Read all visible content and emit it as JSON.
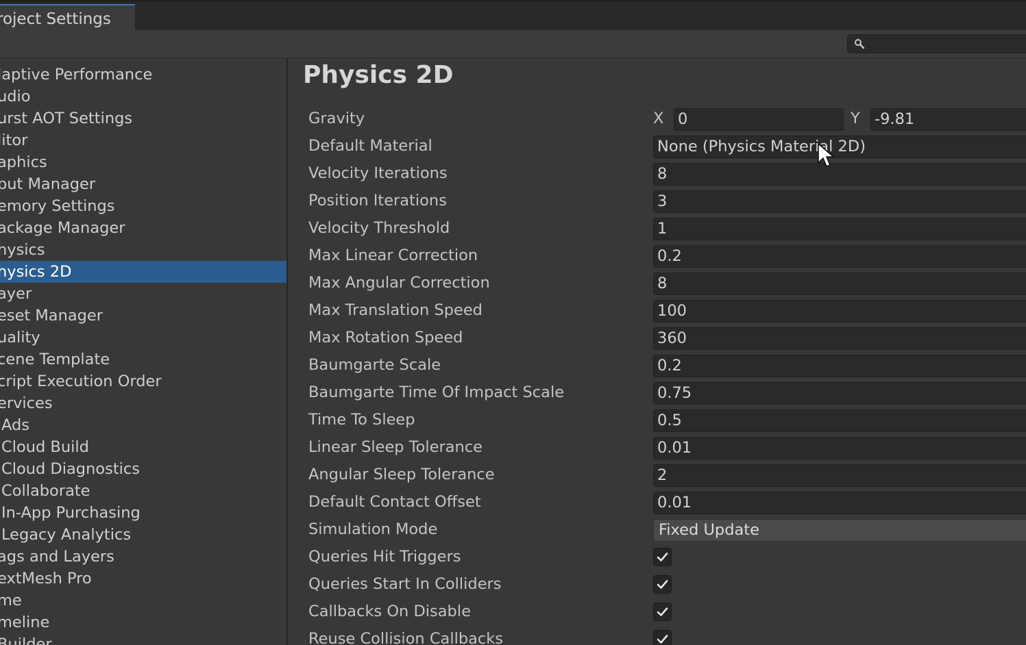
{
  "window": {
    "tab_title": "roject Settings",
    "search_icon": "search-icon"
  },
  "sidebar": {
    "items": [
      {
        "label": "laptive Performance",
        "selected": false
      },
      {
        "label": "udio",
        "selected": false
      },
      {
        "label": "urst AOT Settings",
        "selected": false
      },
      {
        "label": "litor",
        "selected": false
      },
      {
        "label": "aphics",
        "selected": false
      },
      {
        "label": "put Manager",
        "selected": false
      },
      {
        "label": "emory Settings",
        "selected": false
      },
      {
        "label": "ackage Manager",
        "selected": false
      },
      {
        "label": "hysics",
        "selected": false
      },
      {
        "label": "hysics 2D",
        "selected": true
      },
      {
        "label": "ayer",
        "selected": false
      },
      {
        "label": "eset Manager",
        "selected": false
      },
      {
        "label": "uality",
        "selected": false
      },
      {
        "label": "cene Template",
        "selected": false
      },
      {
        "label": "cript Execution Order",
        "selected": false
      },
      {
        "label": "ervices",
        "selected": false
      },
      {
        "label": "Ads",
        "selected": false
      },
      {
        "label": "Cloud Build",
        "selected": false
      },
      {
        "label": "Cloud Diagnostics",
        "selected": false
      },
      {
        "label": "Collaborate",
        "selected": false
      },
      {
        "label": "In-App Purchasing",
        "selected": false
      },
      {
        "label": "Legacy Analytics",
        "selected": false
      },
      {
        "label": "ags and Layers",
        "selected": false
      },
      {
        "label": "extMesh Pro",
        "selected": false
      },
      {
        "label": "me",
        "selected": false
      },
      {
        "label": "meline",
        "selected": false
      },
      {
        "label": "Builder",
        "selected": false
      }
    ]
  },
  "main": {
    "title": "Physics 2D",
    "gravity": {
      "label": "Gravity",
      "x_label": "X",
      "x_value": "0",
      "y_label": "Y",
      "y_value": "-9.81"
    },
    "default_material": {
      "label": "Default Material",
      "value": "None (Physics Material 2D)"
    },
    "fields": [
      {
        "label": "Velocity Iterations",
        "value": "8"
      },
      {
        "label": "Position Iterations",
        "value": "3"
      },
      {
        "label": "Velocity Threshold",
        "value": "1"
      },
      {
        "label": "Max Linear Correction",
        "value": "0.2"
      },
      {
        "label": "Max Angular Correction",
        "value": "8"
      },
      {
        "label": "Max Translation Speed",
        "value": "100"
      },
      {
        "label": "Max Rotation Speed",
        "value": "360"
      },
      {
        "label": "Baumgarte Scale",
        "value": "0.2"
      },
      {
        "label": "Baumgarte Time Of Impact Scale",
        "value": "0.75"
      },
      {
        "label": "Time To Sleep",
        "value": "0.5"
      },
      {
        "label": "Linear Sleep Tolerance",
        "value": "0.01"
      },
      {
        "label": "Angular Sleep Tolerance",
        "value": "2"
      },
      {
        "label": "Default Contact Offset",
        "value": "0.01"
      }
    ],
    "simulation_mode": {
      "label": "Simulation Mode",
      "value": "Fixed Update"
    },
    "checkboxes": [
      {
        "label": "Queries Hit Triggers",
        "checked": true
      },
      {
        "label": "Queries Start In Colliders",
        "checked": true
      },
      {
        "label": "Callbacks On Disable",
        "checked": true
      },
      {
        "label": "Reuse Collision Callbacks",
        "checked": true
      }
    ]
  },
  "colors": {
    "selection": "#2c5d8f",
    "panel": "#383838",
    "field": "#2a2a2a",
    "accent": "#3a79bb"
  }
}
